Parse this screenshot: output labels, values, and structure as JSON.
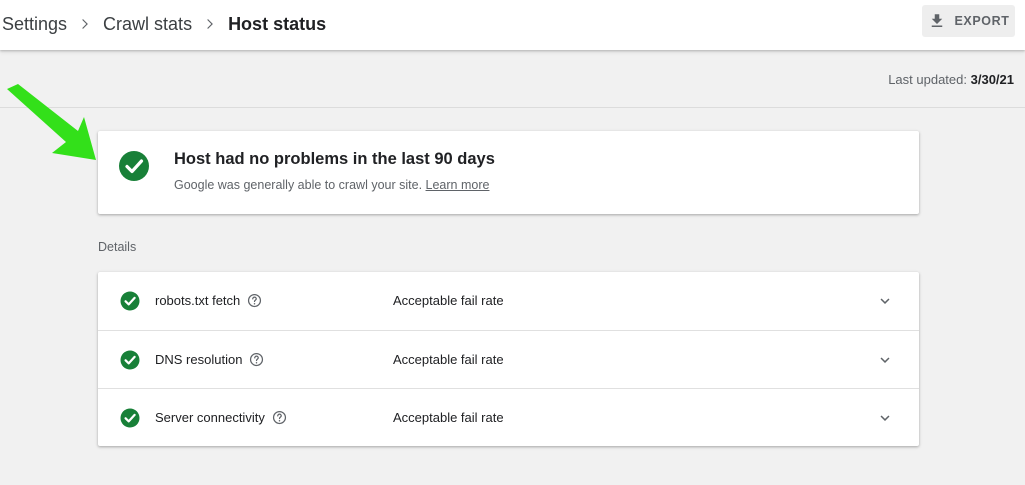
{
  "breadcrumb": {
    "items": [
      "Settings",
      "Crawl stats",
      "Host status"
    ]
  },
  "export_button": {
    "label": "EXPORT"
  },
  "last_updated": {
    "label": "Last updated:",
    "value": "3/30/21"
  },
  "summary": {
    "title": "Host had no problems in the last 90 days",
    "subtitle": "Google was generally able to crawl your site.",
    "link": "Learn more"
  },
  "details": {
    "label": "Details",
    "rows": [
      {
        "name": "robots.txt fetch",
        "status": "Acceptable fail rate"
      },
      {
        "name": "DNS resolution",
        "status": "Acceptable fail rate"
      },
      {
        "name": "Server connectivity",
        "status": "Acceptable fail rate"
      }
    ]
  },
  "colors": {
    "success_green": "#188038",
    "annotation_arrow": "#33e01a",
    "icon_gray": "#5f6368"
  },
  "icons": {
    "breadcrumb_separator": "chevron-right-icon",
    "export": "download-icon",
    "status": "check-circle-icon",
    "help": "help-circle-icon",
    "expand": "chevron-down-icon",
    "annotation": "arrow-icon"
  }
}
